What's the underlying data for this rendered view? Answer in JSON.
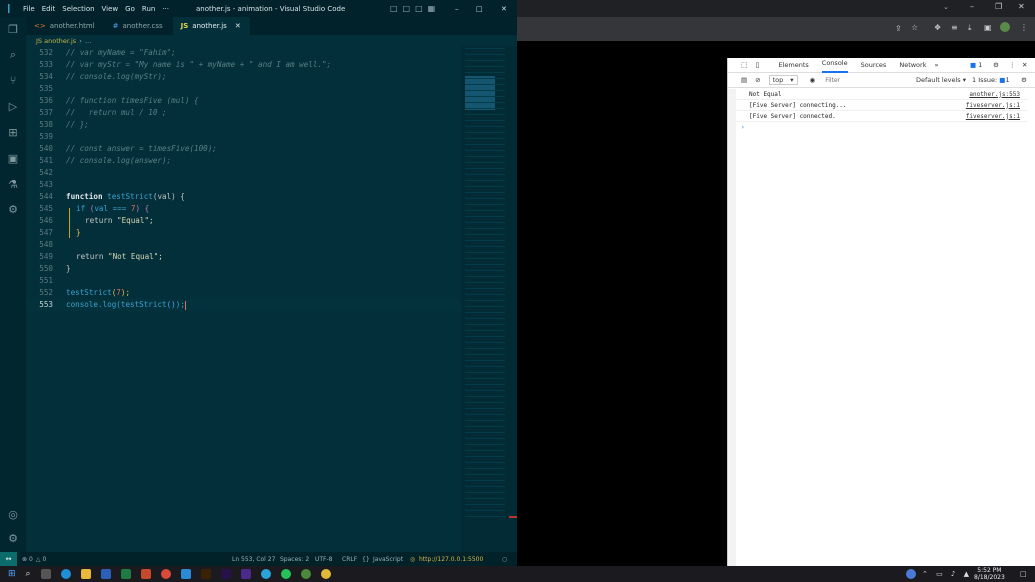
{
  "vscode": {
    "menu": [
      "File",
      "Edit",
      "Selection",
      "View",
      "Go",
      "Run",
      "···"
    ],
    "title": "another.js - animation - Visual Studio Code",
    "tabs": [
      {
        "label": "another.html",
        "icon": "html-icon",
        "active": false
      },
      {
        "label": "another.css",
        "icon": "css-icon",
        "active": false
      },
      {
        "label": "another.js",
        "icon": "js-icon",
        "active": true
      }
    ],
    "breadcrumb": [
      "JS another.js",
      "…"
    ],
    "line_numbers": [
      "532",
      "533",
      "534",
      "535",
      "536",
      "537",
      "538",
      "539",
      "540",
      "541",
      "542",
      "543",
      "544",
      "545",
      "546",
      "547",
      "548",
      "549",
      "550",
      "551",
      "552",
      "553"
    ],
    "comments": {
      "l532": "// var myName = \"Fahim\";",
      "l533": "// var myStr = \"My name is \" + myName + \" and I am well.\";",
      "l534": "// console.log(myStr);",
      "l536": "// function timesFive (mul) {",
      "l537": "//   return mul / 10 ;",
      "l538": "// };",
      "l540": "// const answer = timesFive(100);",
      "l541": "// console.log(answer);"
    },
    "code": {
      "function_kw": "function",
      "fn_name": "testStrict",
      "param": "(val) {",
      "if_kw": "if",
      "if_open": "(",
      "if_val": "val === ",
      "if_num": "7",
      "if_close": ") {",
      "return_kw": "return",
      "str_equal": "\"Equal\";",
      "close_if": "}",
      "str_not_equal": "\"Not Equal\";",
      "close_fn": "}",
      "call_name": "testStrict",
      "call_args_open": "(",
      "call_args_num": "7",
      "call_args_close": ");",
      "console": "console",
      "log": ".log(",
      "inner_call": "testStrict",
      "inner_parens": "()",
      "log_close": ");"
    },
    "status": {
      "errors": "0",
      "warnings": "0",
      "position": "Ln 553, Col 27",
      "spaces": "Spaces: 2",
      "encoding": "UTF-8",
      "eol": "CRLF",
      "language": "JavaScript",
      "server": "http://127.0.0.1:5500"
    }
  },
  "devtools": {
    "tabs": [
      "Elements",
      "Console",
      "Sources",
      "Network"
    ],
    "active_tab": "Console",
    "issues_badge": "1",
    "context": "top",
    "filter_placeholder": "Filter",
    "levels": "Default levels",
    "issue_count": "1 Issue:",
    "issue_badge2": "1",
    "console_lines": [
      {
        "text": "Not Equal",
        "source": "another.js:553"
      },
      {
        "text": "[Five Server] connecting...",
        "source": "fiveserver.js:1"
      },
      {
        "text": "[Five Server] connected.",
        "source": "fiveserver.js:1"
      }
    ],
    "prompt": "›"
  },
  "taskbar": {
    "time": "5:52 PM",
    "date": "8/18/2023"
  },
  "colors": {
    "editor_bg": "#022f3a",
    "accent": "#3aa2cf"
  }
}
